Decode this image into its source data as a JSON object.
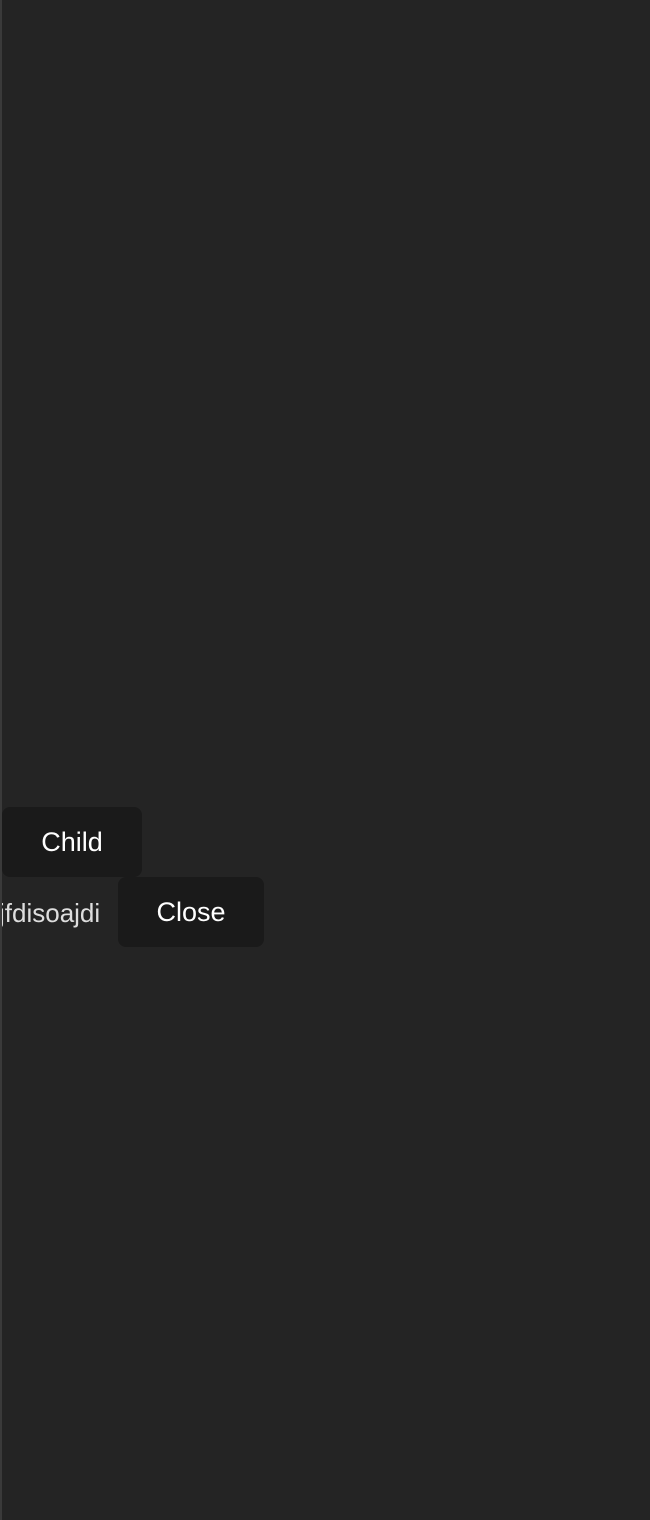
{
  "theme": {
    "background": "#242424",
    "button_background": "#1a1a1a",
    "text_color": "#ffffff"
  },
  "controls": {
    "child_label": "Child",
    "close_label": "Close"
  },
  "popup": {
    "text": "jfdisoajdi"
  }
}
